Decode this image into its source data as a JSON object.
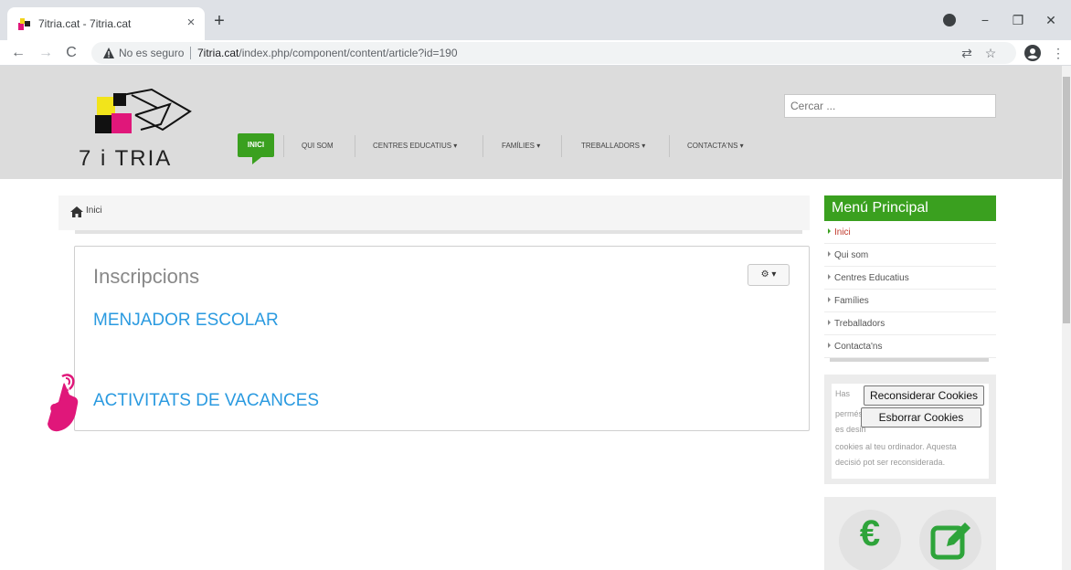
{
  "browser": {
    "tab_title": "7itria.cat - 7itria.cat",
    "tab_close": "×",
    "new_tab": "+",
    "minimize": "−",
    "restore": "❐",
    "close": "✕",
    "back": "←",
    "forward": "→",
    "reload": "C",
    "security_label": "No es seguro",
    "url_host": "7itria.cat",
    "url_path": "/index.php/component/content/article?id=190",
    "translate_icon": "⇄",
    "star_icon": "☆",
    "menu_icon": "⋮"
  },
  "header": {
    "logo_text": "7 i TRIA",
    "search_placeholder": "Cercar ...",
    "nav": [
      {
        "label": "INICI"
      },
      {
        "label": "QUI SOM"
      },
      {
        "label": "CENTRES EDUCATIUS ▾"
      },
      {
        "label": "FAMÍLIES ▾"
      },
      {
        "label": "TREBALLADORS ▾"
      },
      {
        "label": "CONTACTA'NS ▾"
      }
    ]
  },
  "breadcrumb": {
    "home": "Inici"
  },
  "article": {
    "title": "Inscripcions",
    "tools_button": "⚙ ▾",
    "links": [
      {
        "label": "MENJADOR ESCOLAR"
      },
      {
        "label": "ACTIVITATS DE VACANCES"
      }
    ]
  },
  "sidebar": {
    "menu_title": "Menú Principal",
    "menu_items": [
      {
        "label": "Inici"
      },
      {
        "label": "Qui som"
      },
      {
        "label": "Centres Educatius"
      },
      {
        "label": "Famílies"
      },
      {
        "label": "Treballadors"
      },
      {
        "label": "Contacta'ns"
      }
    ],
    "cookies": {
      "line1": "Has",
      "line2": "permés que",
      "line3": "es desin",
      "line4": "cookies al teu ordinador. Aquesta",
      "line5": "decisió pot ser reconsiderada.",
      "reconsider_button": "Reconsiderar Cookies",
      "delete_button": "Esborrar Cookies"
    },
    "euro_symbol": "€"
  },
  "colors": {
    "green": "#3aa01f",
    "link_blue": "#2a9ae0",
    "header_gray": "#dcdcdc",
    "pointer_magenta": "#e0177a"
  }
}
